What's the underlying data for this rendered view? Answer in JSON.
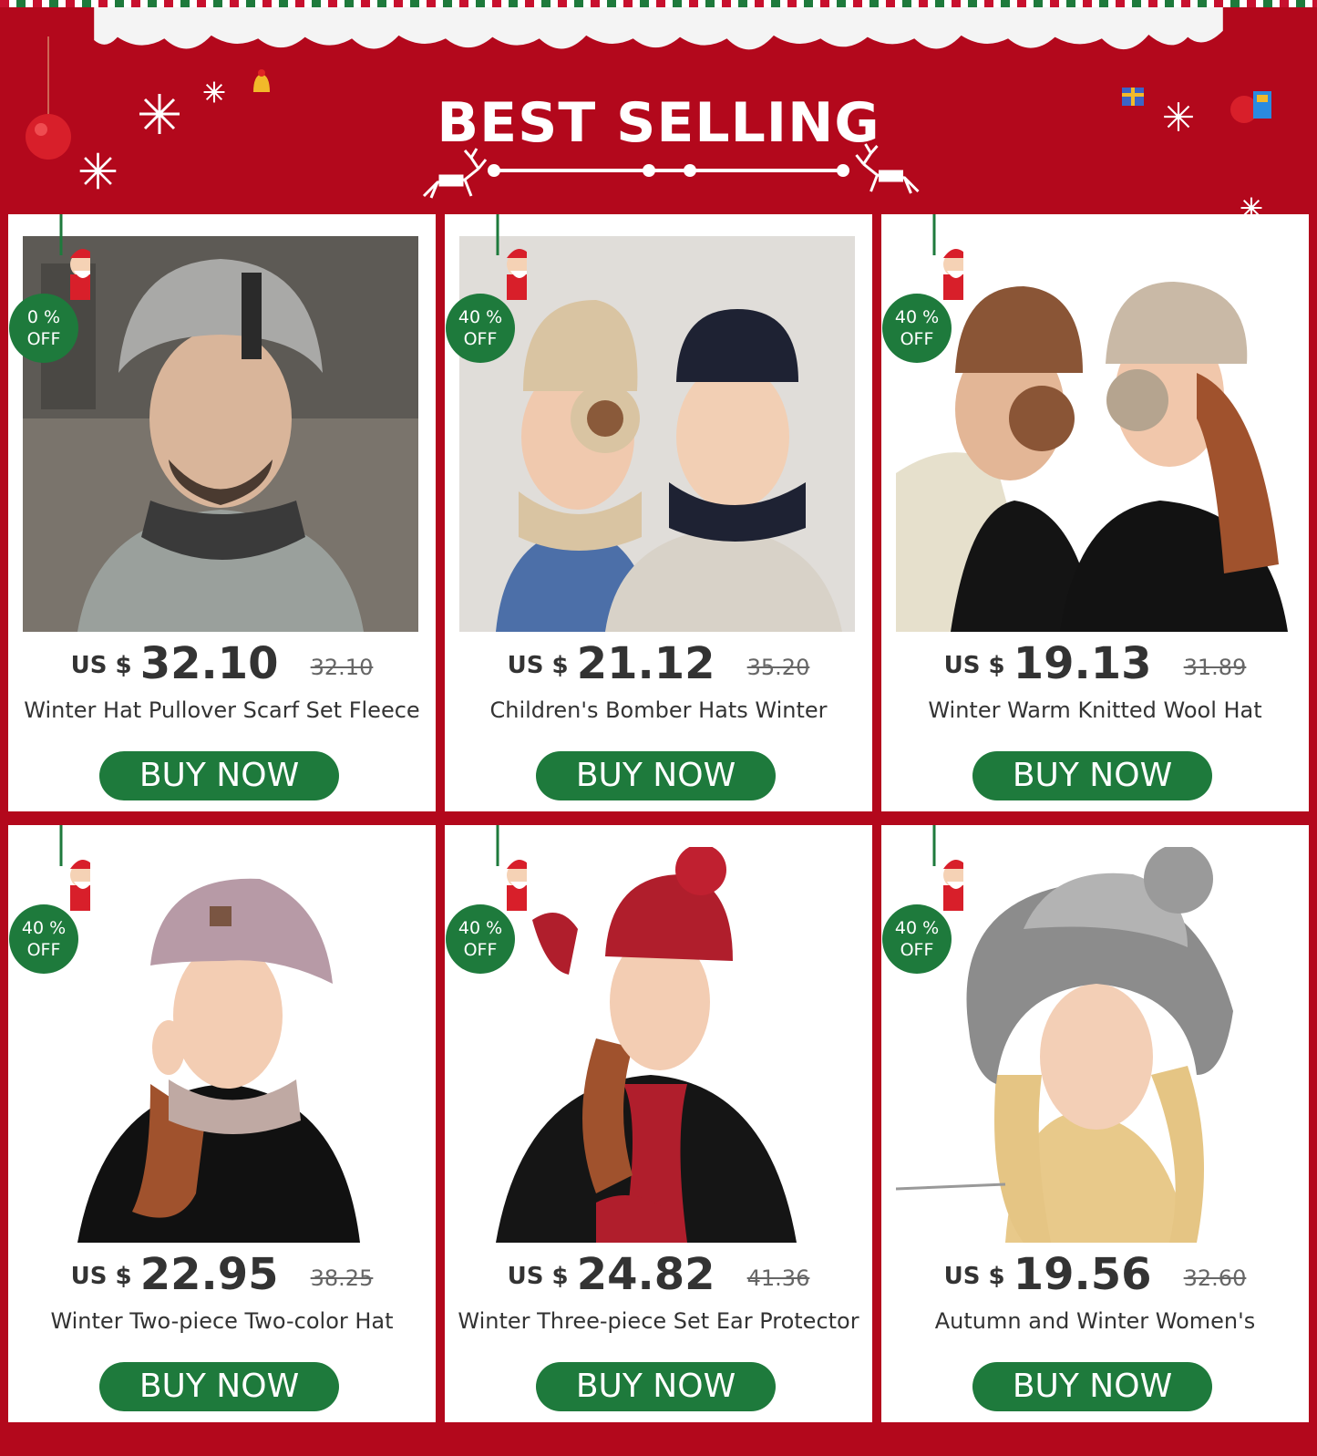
{
  "header": {
    "title": "BEST SELLING"
  },
  "colors": {
    "background": "#b3081c",
    "accent_green": "#1e7a3c",
    "card": "#ffffff",
    "text": "#333333"
  },
  "products": [
    {
      "currency": "US $",
      "price": "32.10",
      "original_price": "32.10",
      "discount_pct": "0 %",
      "discount_off": "OFF",
      "name": "Winter Hat Pullover Scarf Set Fleece",
      "button": "BUY NOW",
      "image_desc": "man-grey-beanie-scarf"
    },
    {
      "currency": "US $",
      "price": "21.12",
      "original_price": "35.20",
      "discount_pct": "40 %",
      "discount_off": "OFF",
      "name": "Children's Bomber Hats Winter",
      "button": "BUY NOW",
      "image_desc": "two-boys-bomber-hats"
    },
    {
      "currency": "US $",
      "price": "19.13",
      "original_price": "31.89",
      "discount_pct": "40 %",
      "discount_off": "OFF",
      "name": "Winter Warm Knitted Wool Hat",
      "button": "BUY NOW",
      "image_desc": "couple-knitted-earflap-hats"
    },
    {
      "currency": "US $",
      "price": "22.95",
      "original_price": "38.25",
      "discount_pct": "40 %",
      "discount_off": "OFF",
      "name": "Winter Two-piece Two-color Hat",
      "button": "BUY NOW",
      "image_desc": "woman-pink-beanie-snood"
    },
    {
      "currency": "US $",
      "price": "24.82",
      "original_price": "41.36",
      "discount_pct": "40 %",
      "discount_off": "OFF",
      "name": "Winter Three-piece Set Ear Protector",
      "button": "BUY NOW",
      "image_desc": "woman-red-hat-scarf-gloves"
    },
    {
      "currency": "US $",
      "price": "19.56",
      "original_price": "32.60",
      "discount_pct": "40 %",
      "discount_off": "OFF",
      "name": "Autumn and Winter Women's",
      "button": "BUY NOW",
      "image_desc": "woman-grey-fur-trim-hat"
    }
  ]
}
